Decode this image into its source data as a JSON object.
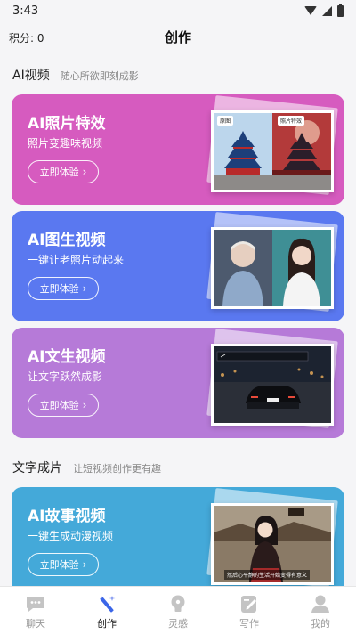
{
  "status": {
    "time": "3:43"
  },
  "header": {
    "points_label": "积分: 0",
    "title": "创作"
  },
  "sections": [
    {
      "title": "AI视频",
      "subtitle": "随心所欲即刻成影"
    },
    {
      "title": "文字成片",
      "subtitle": "让短视频创作更有趣"
    }
  ],
  "cards": [
    {
      "title": "AI照片特效",
      "subtitle": "照片变趣味视频",
      "button": "立即体验",
      "color": "#d65bbf",
      "thumb_tags": [
        "原图",
        "照片特效"
      ]
    },
    {
      "title": "AI图生视频",
      "subtitle": "一键让老照片动起来",
      "button": "立即体验",
      "color": "#5a78f0"
    },
    {
      "title": "AI文生视频",
      "subtitle": "让文字跃然成影",
      "button": "立即体验",
      "color": "#b67ad8"
    },
    {
      "title": "AI故事视频",
      "subtitle": "一键生成动漫视频",
      "button": "立即体验",
      "color": "#44a9d9",
      "thumb_caption": "然后心平静的生活开始变得有意义"
    }
  ],
  "nav": [
    {
      "label": "聊天",
      "icon": "chat-icon",
      "active": false
    },
    {
      "label": "创作",
      "icon": "magic-wand-icon",
      "active": true
    },
    {
      "label": "灵感",
      "icon": "lightbulb-icon",
      "active": false
    },
    {
      "label": "写作",
      "icon": "edit-icon",
      "active": false
    },
    {
      "label": "我的",
      "icon": "profile-icon",
      "active": false
    }
  ]
}
